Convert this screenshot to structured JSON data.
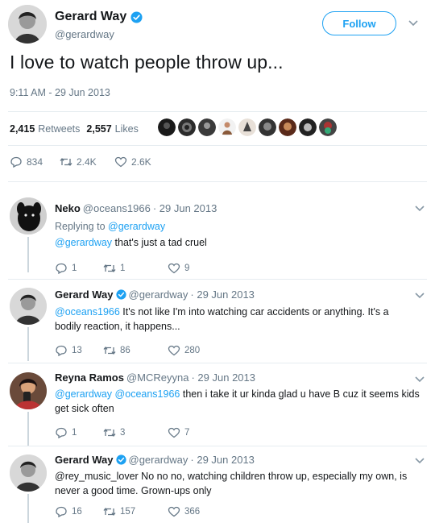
{
  "main": {
    "name": "Gerard Way",
    "handle": "@gerardway",
    "follow_label": "Follow",
    "text": "I love to watch people throw up...",
    "timestamp": "9:11 AM - 29 Jun 2013",
    "retweets_count": "2,415",
    "retweets_label": "Retweets",
    "likes_count": "2,557",
    "likes_label": "Likes",
    "replies": "834",
    "retweets": "2.4K",
    "likes": "2.6K"
  },
  "replies": [
    {
      "name": "Neko",
      "handle": "@oceans1966",
      "date": "· 29 Jun 2013",
      "replying_to_label": "Replying to",
      "replying_to": "@gerardway",
      "mention": "@gerardway",
      "text": "that's just a tad cruel",
      "replies": "1",
      "retweets": "1",
      "likes": "9"
    },
    {
      "name": "Gerard Way",
      "handle": "@gerardway",
      "date": "· 29 Jun 2013",
      "mention": "@oceans1966",
      "text_line1": "It's not like I'm into watching car accidents or anything. It's a",
      "text_line2": "bodily reaction, it happens...",
      "replies": "13",
      "retweets": "86",
      "likes": "280"
    },
    {
      "name": "Reyna Ramos",
      "handle": "@MCReyyna",
      "date": "· 29 Jun 2013",
      "mention1": "@gerardway",
      "mention2": "@oceans1966",
      "text_line1": "then i take it ur kinda glad u have B cuz it seems kids",
      "text_line2": "get sick often",
      "replies": "1",
      "retweets": "3",
      "likes": "7"
    },
    {
      "name": "Gerard Way",
      "handle": "@gerardway",
      "date": "· 29 Jun 2013",
      "text_line1": "@rey_music_lover No no no, watching children throw up, especially my own, is",
      "text_line2": "never a good time. Grown-ups only",
      "replies": "16",
      "retweets": "157",
      "likes": "366"
    }
  ],
  "icons": {
    "reply": "reply-icon",
    "retweet": "retweet-icon",
    "like": "heart-icon",
    "verified": "verified-badge-icon",
    "more": "chevron-down-icon"
  },
  "colors": {
    "accent": "#1da1f2",
    "muted": "#657786",
    "text": "#14171a",
    "divider": "#e6ecf0"
  }
}
